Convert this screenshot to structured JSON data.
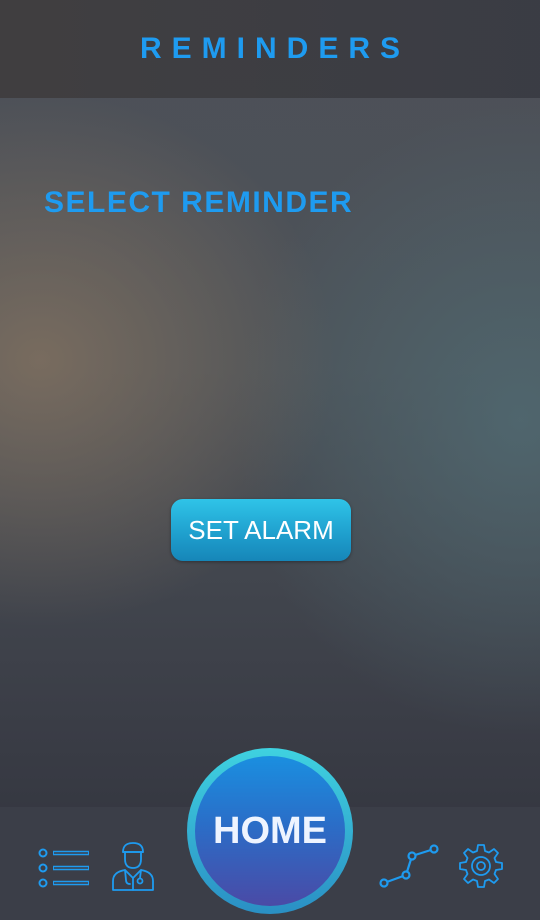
{
  "header": {
    "title": "REMINDERS"
  },
  "main": {
    "section_title": "SELECT REMINDER",
    "set_alarm_label": "SET ALARM"
  },
  "nav": {
    "home_label": "HOME",
    "icons": [
      "list-icon",
      "doctor-icon",
      "chart-line-icon",
      "gear-icon"
    ]
  },
  "colors": {
    "accent": "#1e9bf0",
    "button": "#2fc4e8",
    "bar": "#3b3e48"
  }
}
